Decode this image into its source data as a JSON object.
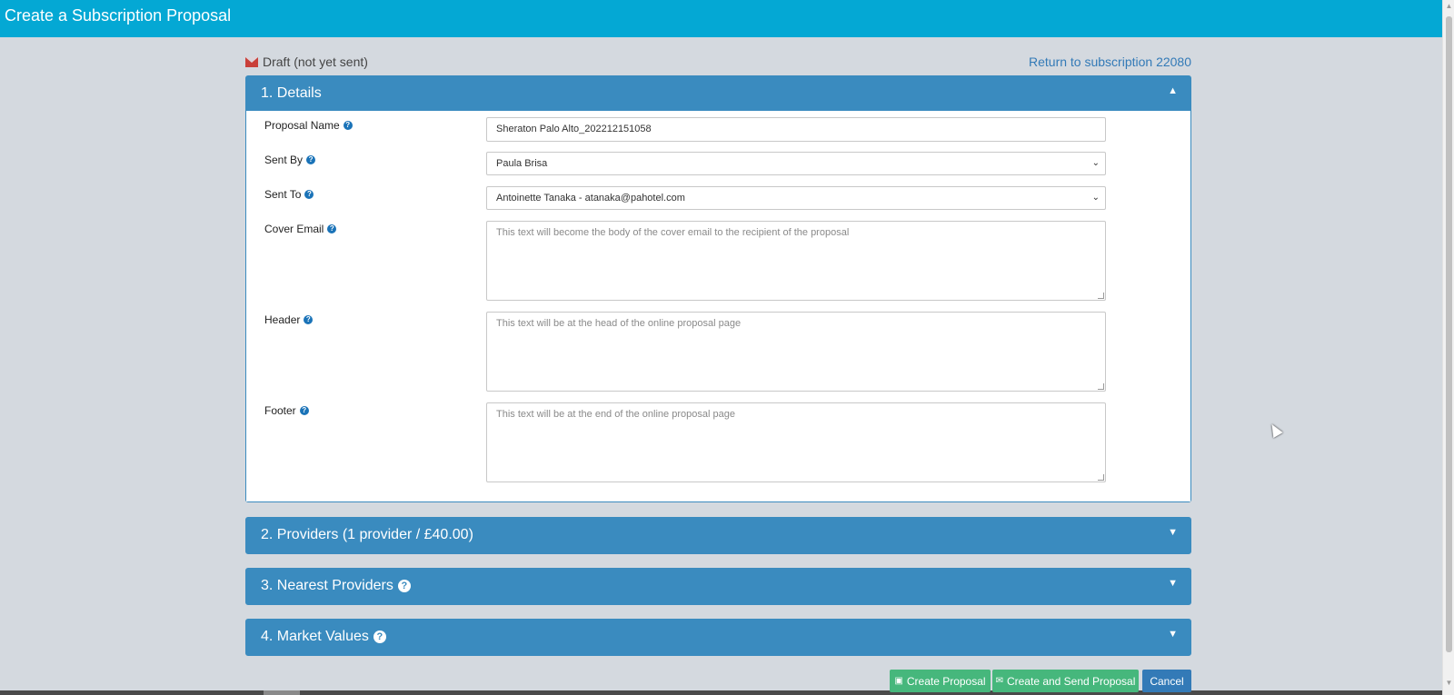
{
  "app": {
    "title": "Create a Subscription Proposal"
  },
  "status": {
    "icon": "envelope-icon",
    "text": "Draft (not yet sent)"
  },
  "return_link": "Return to subscription 22080",
  "sections": {
    "details": {
      "title": "1. Details",
      "expanded": true
    },
    "providers": {
      "title": "2. Providers (1 provider / £40.00)",
      "expanded": false
    },
    "nearest": {
      "title": "3. Nearest Providers",
      "expanded": false
    },
    "market": {
      "title": "4. Market Values",
      "expanded": false
    }
  },
  "form": {
    "proposal_name": {
      "label": "Proposal Name",
      "value": "Sheraton Palo Alto_202212151058"
    },
    "sent_by": {
      "label": "Sent By",
      "value": "Paula Brisa"
    },
    "sent_to": {
      "label": "Sent To",
      "value": "Antoinette Tanaka - atanaka@pahotel.com"
    },
    "cover_email": {
      "label": "Cover Email",
      "placeholder": "This text will become the body of the cover email to the recipient of the proposal"
    },
    "header": {
      "label": "Header",
      "placeholder": "This text will be at the head of the online proposal page"
    },
    "footer": {
      "label": "Footer",
      "placeholder": "This text will be at the end of the online proposal page"
    }
  },
  "buttons": {
    "create": "Create Proposal",
    "create_send": "Create and Send Proposal",
    "cancel": "Cancel"
  },
  "colors": {
    "header_bg": "#04a8d4",
    "panel": "#3a8bbf",
    "success": "#46b77c",
    "primary": "#337ab7"
  }
}
